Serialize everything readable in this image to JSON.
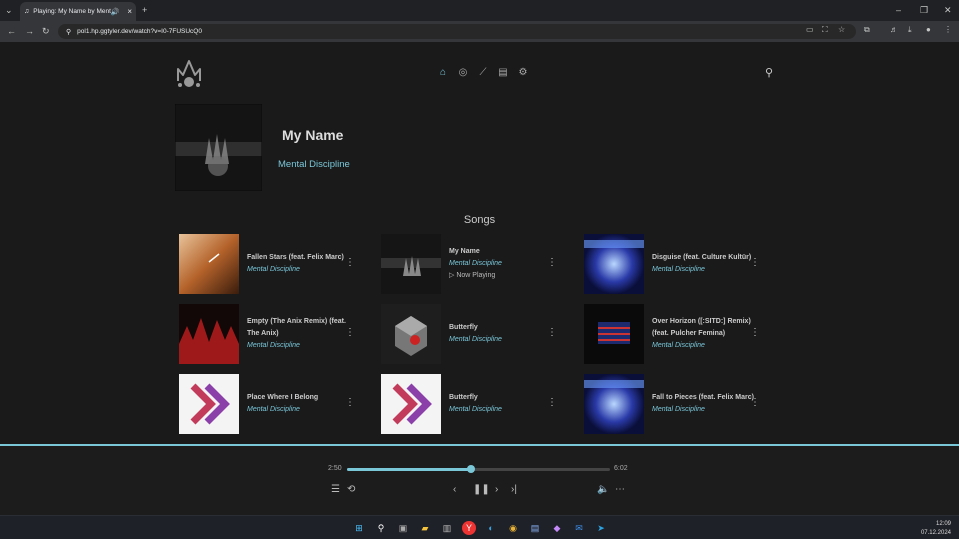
{
  "browser": {
    "tab_title": "Playing: My Name by Ment",
    "url": "pol1.hp.ggtyler.dev/watch?v=I0-7FUSUcQ0"
  },
  "album": {
    "title": "My Name",
    "artist": "Mental Discipline"
  },
  "songs_heading": "Songs",
  "songs": [
    {
      "title": "Fallen Stars (feat. Felix Marc)",
      "artist": "Mental Discipline",
      "thumb": "warm"
    },
    {
      "title": "My Name",
      "artist": "Mental Discipline",
      "now_playing": "Now Playing",
      "thumb": "dark"
    },
    {
      "title": "Disguise (feat. Culture Kultür)",
      "artist": "Mental Discipline",
      "thumb": "blue"
    },
    {
      "title": "Empty (The Anix Remix) (feat. The Anix)",
      "artist": "Mental Discipline",
      "thumb": "red"
    },
    {
      "title": "Butterfly",
      "artist": "Mental Discipline",
      "thumb": "cube"
    },
    {
      "title": "Over Horizon ([:SITD:] Remix) (feat. Pulcher Femina)",
      "artist": "Mental Discipline",
      "thumb": "flag"
    },
    {
      "title": "Place Where I Belong",
      "artist": "Mental Discipline",
      "thumb": "arrows"
    },
    {
      "title": "Butterfly",
      "artist": "Mental Discipline",
      "thumb": "arrows"
    },
    {
      "title": "Fall to Pieces (feat. Felix Marc)",
      "artist": "Mental Discipline",
      "thumb": "blue"
    }
  ],
  "player": {
    "current_time": "2:50",
    "duration": "6:02",
    "progress_fraction": 0.47
  },
  "taskbar": {
    "time": "12:09",
    "date": "07.12.2024"
  },
  "colors": {
    "accent": "#7ac7d8",
    "background": "#1a1a1b"
  }
}
